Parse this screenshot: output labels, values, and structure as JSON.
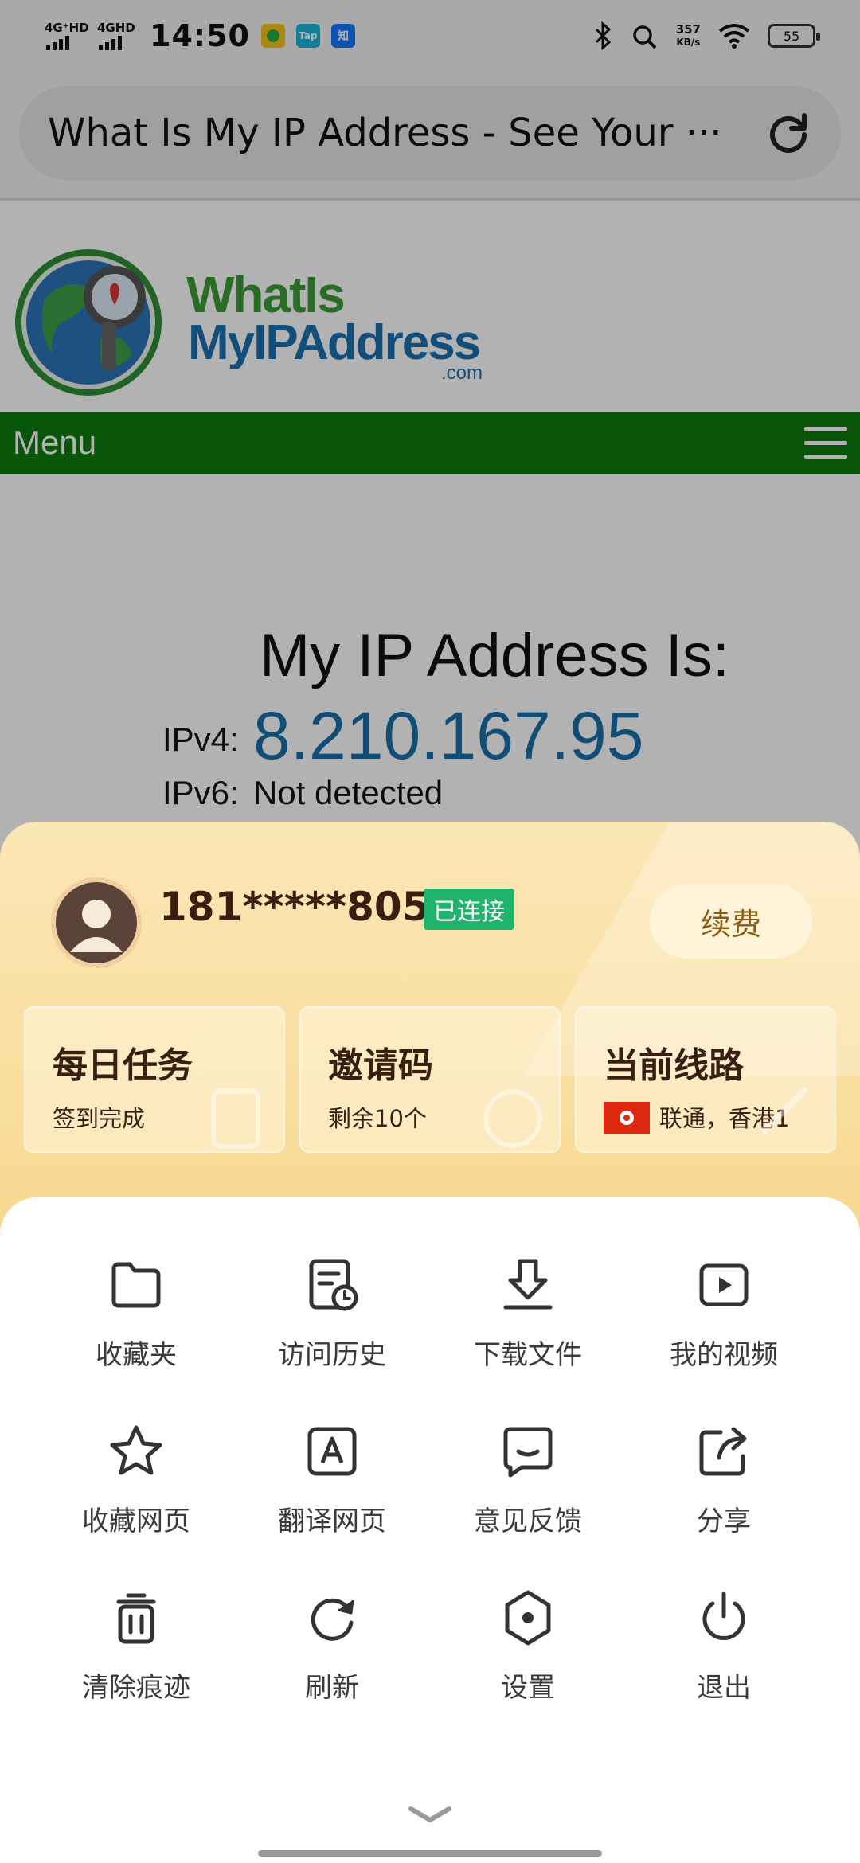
{
  "status_bar": {
    "signal1": "4G⁺HD",
    "signal2": "4GHD",
    "time": "14:50",
    "app1": "",
    "app2": "Tap",
    "app3": "知",
    "speed_value": "357",
    "speed_unit": "KB/s",
    "battery": "55"
  },
  "browser": {
    "url_title": "What Is My IP Address - See Your ···"
  },
  "site": {
    "logo_line1": "WhatIs",
    "logo_line2": "MyIPAddress",
    "logo_line3": ".com",
    "menu_label": "Menu",
    "heading": "My IP Address Is:",
    "ipv4_label": "IPv4:",
    "ipv4_value": "8.210.167.95",
    "ipv6_label": "IPv6:",
    "ipv6_value": "Not detected"
  },
  "account": {
    "phone": "181*****805",
    "status": "已连接",
    "renew": "续费",
    "cards": [
      {
        "title": "每日任务",
        "sub": "签到完成"
      },
      {
        "title": "邀请码",
        "sub": "剩余10个"
      },
      {
        "title": "当前线路",
        "sub": "联通，香港1"
      }
    ]
  },
  "menu": {
    "items": [
      {
        "label": "收藏夹",
        "icon": "folder-icon"
      },
      {
        "label": "访问历史",
        "icon": "history-icon"
      },
      {
        "label": "下载文件",
        "icon": "download-icon"
      },
      {
        "label": "我的视频",
        "icon": "video-icon"
      },
      {
        "label": "收藏网页",
        "icon": "star-icon"
      },
      {
        "label": "翻译网页",
        "icon": "translate-icon"
      },
      {
        "label": "意见反馈",
        "icon": "feedback-icon"
      },
      {
        "label": "分享",
        "icon": "share-icon"
      },
      {
        "label": "清除痕迹",
        "icon": "trash-icon"
      },
      {
        "label": "刷新",
        "icon": "refresh-icon"
      },
      {
        "label": "设置",
        "icon": "settings-icon"
      },
      {
        "label": "退出",
        "icon": "power-icon"
      }
    ]
  },
  "colors": {
    "accent_green": "#0e7a0e",
    "ip_blue": "#1a6fa9",
    "connected_badge": "#1fb36b",
    "panel_gold": "#f9dd9b"
  }
}
